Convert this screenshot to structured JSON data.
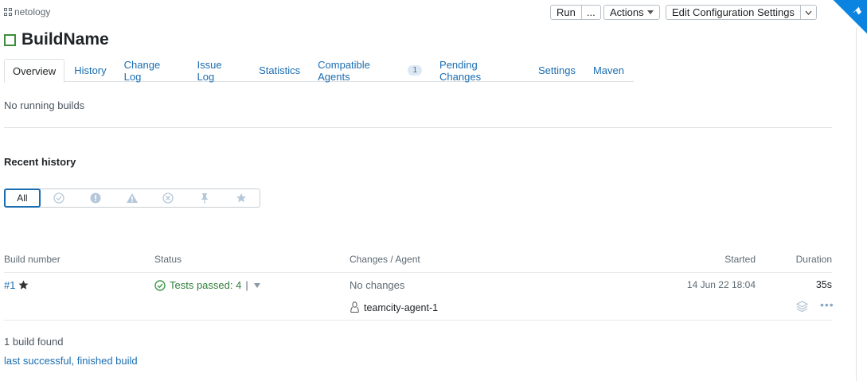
{
  "header": {
    "project": "netology",
    "run_label": "Run",
    "run_more_label": "...",
    "actions_label": "Actions",
    "edit_label": "Edit Configuration Settings",
    "title": "BuildName"
  },
  "tabs": [
    {
      "label": "Overview"
    },
    {
      "label": "History"
    },
    {
      "label": "Change Log"
    },
    {
      "label": "Issue Log"
    },
    {
      "label": "Statistics"
    },
    {
      "label": "Compatible Agents",
      "badge": "1"
    },
    {
      "label": "Pending Changes"
    },
    {
      "label": "Settings"
    },
    {
      "label": "Maven"
    }
  ],
  "overview": {
    "no_running": "No running builds",
    "recent_history": "Recent history",
    "filters": {
      "all": "All",
      "icons": [
        "success-icon",
        "failed-icon",
        "warning-icon",
        "cancelled-icon",
        "pinned-icon",
        "starred-icon"
      ]
    }
  },
  "table": {
    "headers": {
      "build_number": "Build number",
      "status": "Status",
      "changes_agent": "Changes / Agent",
      "started": "Started",
      "duration": "Duration"
    },
    "rows": [
      {
        "number": "#1",
        "status": "Tests passed: 4",
        "changes": "No changes",
        "agent": "teamcity-agent-1",
        "started": "14 Jun 22 18:04",
        "duration": "35s"
      }
    ]
  },
  "footer": {
    "found": "1 build found",
    "link": "last successful, finished build"
  },
  "colors": {
    "link": "#1a6db1",
    "success": "#3d9a4a",
    "corner": "#0a84e0"
  }
}
